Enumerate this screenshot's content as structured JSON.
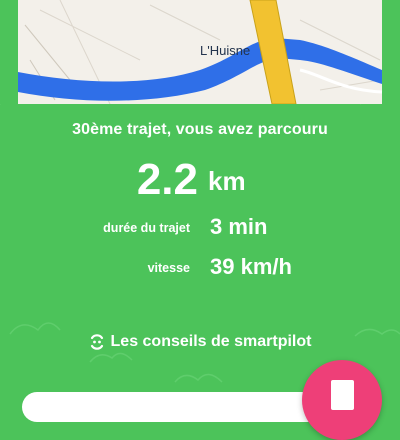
{
  "map": {
    "river_label": "L'Huisne",
    "colors": {
      "land": "#f3f0ea",
      "water": "#2f6fe8",
      "road": "#f2c230",
      "road_edge": "#c9a21a"
    }
  },
  "trip": {
    "header": "30ème trajet, vous avez parcouru",
    "distance_value": "2.2",
    "distance_unit": "km",
    "duration_label": "durée du trajet",
    "duration_value": "3 min",
    "speed_label": "vitesse",
    "speed_value": "39 km/h"
  },
  "tips": {
    "label": "Les conseils de smartpilot",
    "icon": "smartpilot-icon"
  },
  "actions": {
    "primary_icon": "stop-icon"
  },
  "colors": {
    "background": "#4cc35a",
    "accent": "#ee3f78",
    "text": "#ffffff"
  }
}
